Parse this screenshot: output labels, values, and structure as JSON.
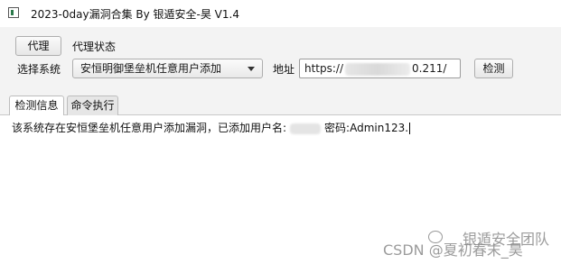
{
  "window": {
    "title": "2023-0day漏洞合集 By 银遁安全-昊 V1.4"
  },
  "toolbar": {
    "proxy_button": "代理",
    "proxy_status_label": "代理状态",
    "select_label": "选择系统",
    "select_value": "安恒明御堡垒机任意用户添加",
    "address_label": "地址",
    "address_value_prefix": "https://",
    "address_value_suffix": "0.211/",
    "detect_button": "检测"
  },
  "tabs": [
    {
      "label": "检测信息",
      "active": true
    },
    {
      "label": "命令执行",
      "active": false
    }
  ],
  "output": {
    "text_before_user": "该系统存在安恒堡垒机任意用户添加漏洞，已添加用户名:",
    "text_after_user": "密码:Admin123."
  },
  "watermark": {
    "line1": "银遁安全团队",
    "line2": "CSDN @夏初春末_昊"
  },
  "icons": {
    "app": "window-icon",
    "dropdown": "chevron-down-icon",
    "watermark_logo": "wechat-icon"
  }
}
